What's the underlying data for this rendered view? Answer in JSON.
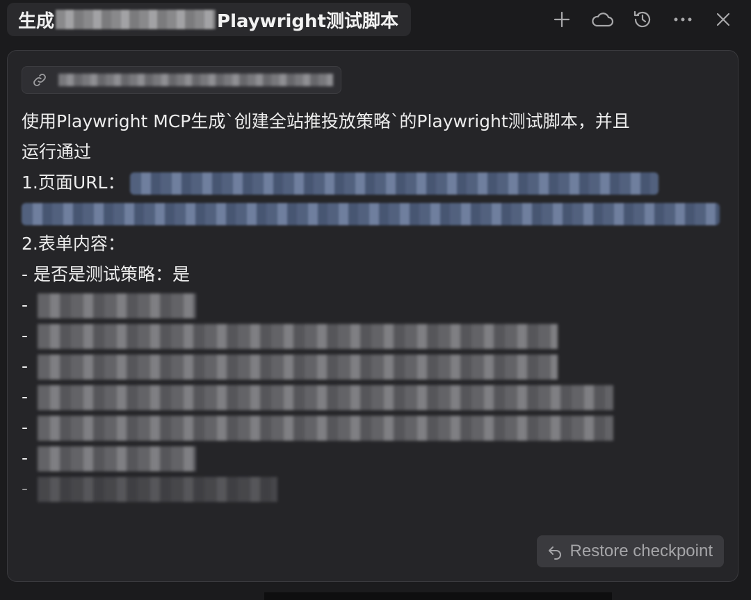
{
  "header": {
    "title_prefix": "生成",
    "title_suffix": "Playwright测试脚本",
    "icons": [
      "plus-icon",
      "cloud-icon",
      "history-icon",
      "more-icon",
      "close-icon"
    ]
  },
  "message": {
    "line1": "使用Playwright MCP生成`创建全站推投放策略`的Playwright测试脚本，并且",
    "line2": "运行通过",
    "url_label": "1.页面URL：",
    "form_label": "2.表单内容：",
    "bullet_test": "- 是否是测试策略：是",
    "dash": "-"
  },
  "actions": {
    "restore_label": "Restore checkpoint"
  },
  "colors": {
    "background": "#1b1b1d",
    "card": "#252528",
    "text": "#ececec",
    "link_highlight": "#5a6c8e"
  }
}
